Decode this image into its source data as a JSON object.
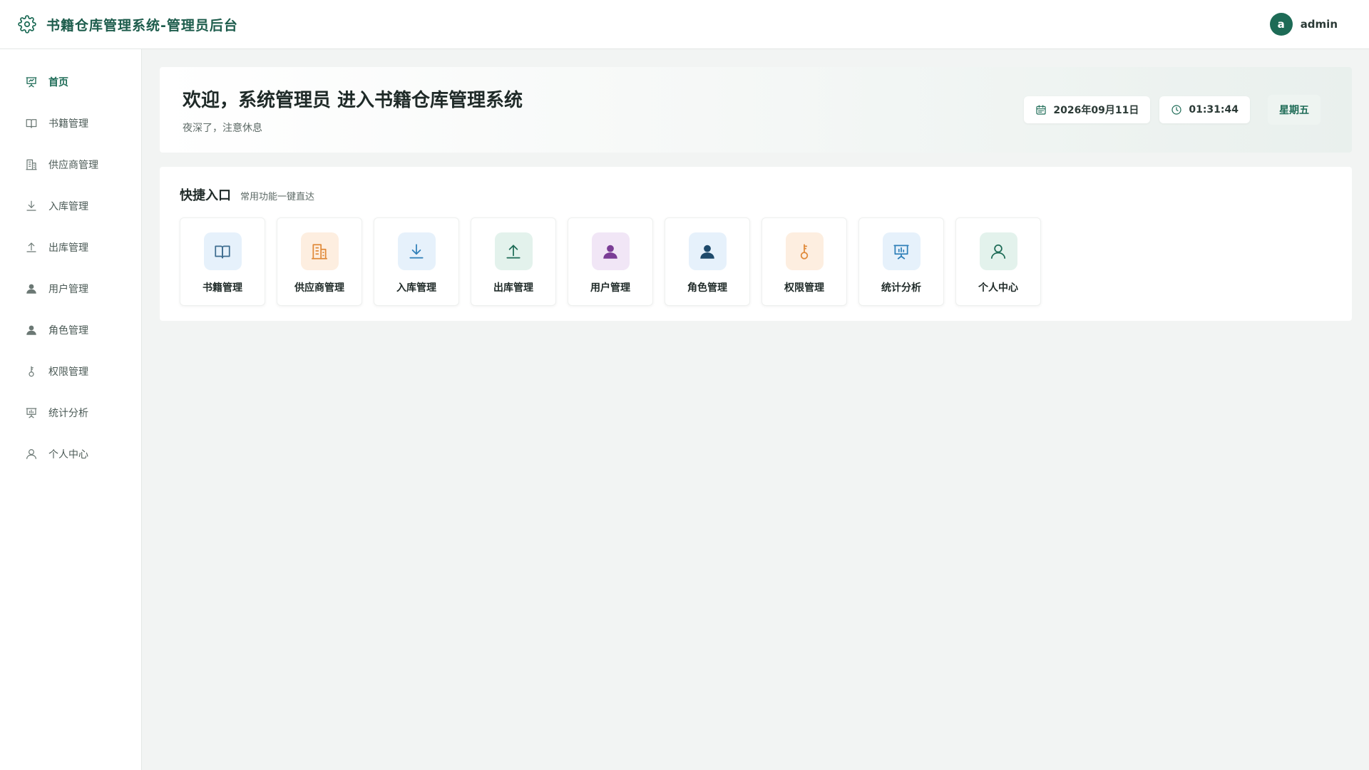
{
  "header": {
    "title": "书籍仓库管理系统-管理员后台",
    "avatar_letter": "a",
    "username": "admin"
  },
  "sidebar": {
    "items": [
      {
        "label": "首页",
        "icon": "presentation-icon",
        "active": true
      },
      {
        "label": "书籍管理",
        "icon": "book-icon"
      },
      {
        "label": "供应商管理",
        "icon": "building-icon"
      },
      {
        "label": "入库管理",
        "icon": "download-icon"
      },
      {
        "label": "出库管理",
        "icon": "upload-icon"
      },
      {
        "label": "用户管理",
        "icon": "user-filled-icon"
      },
      {
        "label": "角色管理",
        "icon": "user-filled-icon"
      },
      {
        "label": "权限管理",
        "icon": "key-icon"
      },
      {
        "label": "统计分析",
        "icon": "presentation-icon"
      },
      {
        "label": "个人中心",
        "icon": "user-outline-icon"
      }
    ]
  },
  "welcome": {
    "title": "欢迎，系统管理员 进入书籍仓库管理系统",
    "subtitle": "夜深了，注意休息",
    "date": "2026年09月11日",
    "time": "01:31:44",
    "weekday": "星期五"
  },
  "quick": {
    "title": "快捷入口",
    "subtitle": "常用功能一键直达",
    "cards": [
      {
        "label": "书籍管理",
        "icon": "book-icon",
        "color": "#3d6c8f",
        "bg": "#e6f1fb"
      },
      {
        "label": "供应商管理",
        "icon": "building-icon",
        "color": "#e08a3a",
        "bg": "#fdeee0"
      },
      {
        "label": "入库管理",
        "icon": "download-icon",
        "color": "#2f7fb8",
        "bg": "#e6f1fb"
      },
      {
        "label": "出库管理",
        "icon": "upload-icon",
        "color": "#1d6b56",
        "bg": "#e3f2ec"
      },
      {
        "label": "用户管理",
        "icon": "user-filled-icon",
        "color": "#7b3d96",
        "bg": "#f1e6f6"
      },
      {
        "label": "角色管理",
        "icon": "user-filled-icon",
        "color": "#1e4a6b",
        "bg": "#e6f1fb"
      },
      {
        "label": "权限管理",
        "icon": "key-icon",
        "color": "#e08a3a",
        "bg": "#fdeee0"
      },
      {
        "label": "统计分析",
        "icon": "presentation-icon",
        "color": "#2f7fb8",
        "bg": "#e6f1fb"
      },
      {
        "label": "个人中心",
        "icon": "user-outline-icon",
        "color": "#1d6b56",
        "bg": "#e3f2ec"
      }
    ]
  },
  "colors": {
    "brand": "#1d6b56",
    "background": "#f2f4f3"
  }
}
